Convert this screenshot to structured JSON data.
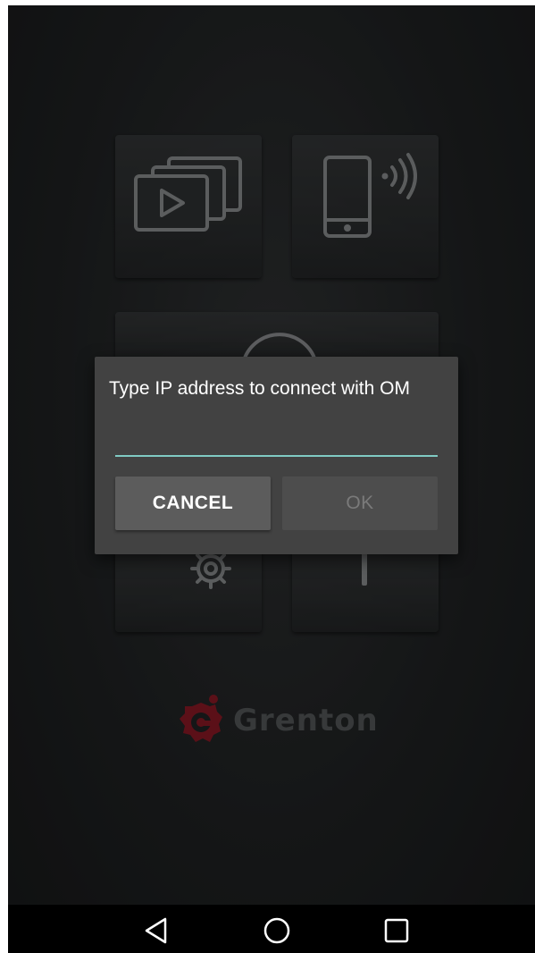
{
  "dialog": {
    "title": "Type IP address to connect with OM",
    "input_value": "",
    "input_placeholder": "",
    "cancel_label": "CANCEL",
    "ok_label": "OK"
  },
  "brand": {
    "logo_text": "Grenton",
    "logo_color": "#8b1a24"
  },
  "tiles": {
    "gallery_icon": "media-gallery-icon",
    "remote_icon": "phone-wireless-icon",
    "play_icon": "play-circle-icon",
    "settings_icon": "gears-icon",
    "info_icon": "info-icon"
  },
  "accent_color": "#80cbc4",
  "navbar": {
    "back_icon": "back-triangle-icon",
    "home_icon": "home-circle-icon",
    "recents_icon": "recents-square-icon"
  }
}
